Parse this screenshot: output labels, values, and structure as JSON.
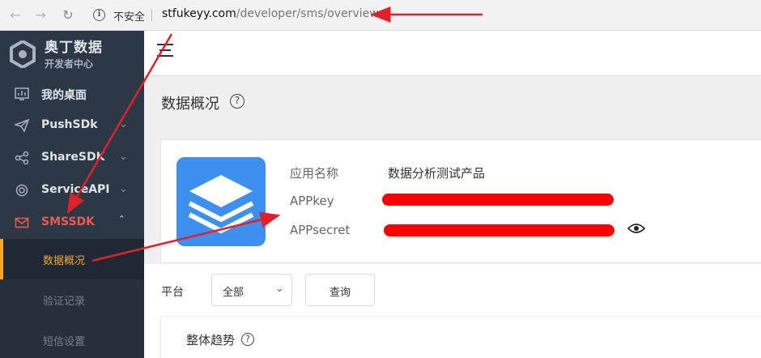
{
  "browser": {
    "security_label": "不安全",
    "url_host": "stfukeyy.com",
    "url_path": "/developer/sms/overview"
  },
  "sidebar": {
    "brand_name": "奥丁数据",
    "brand_subtitle": "开发者中心",
    "items": [
      {
        "label": "我的桌面",
        "icon": "dashboard-icon"
      },
      {
        "label": "PushSDk",
        "icon": "send-icon",
        "chevron": "chevron-down-icon"
      },
      {
        "label": "ShareSDK",
        "icon": "share-icon",
        "chevron": "chevron-down-icon"
      },
      {
        "label": "ServiceAPI",
        "icon": "target-icon",
        "chevron": "chevron-down-icon"
      },
      {
        "label": "SMSSDK",
        "icon": "mail-icon",
        "chevron": "chevron-up-icon",
        "active": true
      }
    ],
    "subitems": [
      {
        "label": "数据概况",
        "active": true
      },
      {
        "label": "验证记录"
      },
      {
        "label": "短信设置"
      }
    ]
  },
  "page": {
    "title": "数据概况",
    "app_info": {
      "name_label": "应用名称",
      "name_value": "数据分析测试产品",
      "appkey_label": "APPkey",
      "appsecret_label": "APPsecret"
    },
    "filter": {
      "platform_label": "平台",
      "platform_selected": "全部",
      "query_label": "查询"
    },
    "trend_title": "整体趋势"
  },
  "colors": {
    "sidebar_bg": "#2d3847",
    "accent_orange": "#f5a623",
    "active_red": "#ee5a4f",
    "app_logo_blue": "#3d8ff0",
    "annotation_red": "#e0202a"
  }
}
